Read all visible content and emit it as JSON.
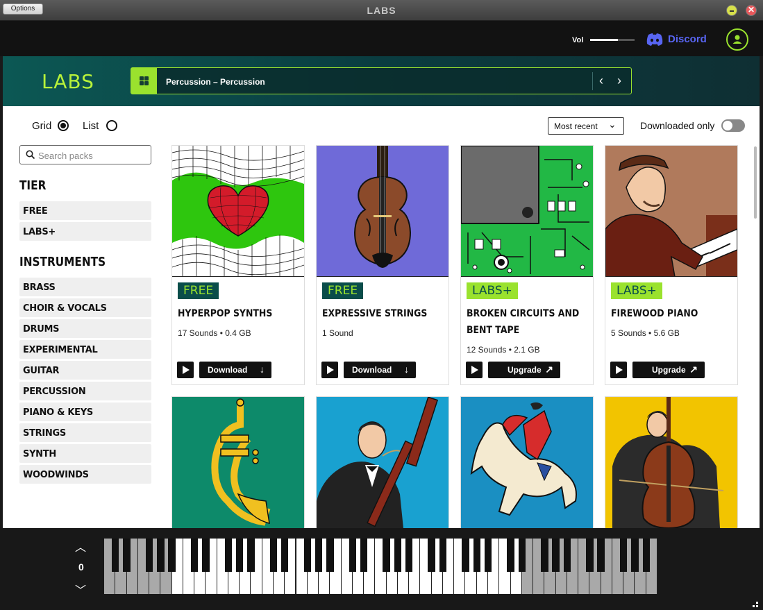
{
  "window": {
    "title": "LABS",
    "options_label": "Options",
    "close_glyph": "✕"
  },
  "topbar": {
    "vol_label": "Vol",
    "volume_level": 0.62,
    "discord_label": "Discord"
  },
  "header": {
    "logo": "LABS",
    "preset_name": "Perсussion  –  Perсussion",
    "prev_glyph": "‹",
    "next_glyph": "›"
  },
  "view": {
    "grid_label": "Grid",
    "list_label": "List",
    "selected": "Grid"
  },
  "sort": {
    "selected": "Most recent",
    "chevron": "⌄"
  },
  "downloaded_only": {
    "label": "Downloaded only",
    "enabled": false
  },
  "search": {
    "placeholder": "Search packs"
  },
  "tier": {
    "title": "TIER",
    "items": [
      "FREE",
      "LABS+"
    ]
  },
  "instruments": {
    "title": "INSTRUMENTS",
    "items": [
      "BRASS",
      "CHOIR & VOCALS",
      "DRUMS",
      "EXPERIMENTAL",
      "GUITAR",
      "PERCUSSION",
      "PIANO & KEYS",
      "STRINGS",
      "SYNTH",
      "WOODWINDS"
    ]
  },
  "cards": [
    {
      "badge": "FREE",
      "title": "HYPERPOP SYNTHS",
      "meta": "17 Sounds • 0.4 GB",
      "action": "Download",
      "action_icon": "↓"
    },
    {
      "badge": "FREE",
      "title": "EXPRESSIVE STRINGS",
      "meta": "1 Sound",
      "action": "Download",
      "action_icon": "↓"
    },
    {
      "badge": "LABS+",
      "title": "BROKEN CIRCUITS AND BENT TAPE",
      "meta": "12 Sounds • 2.1 GB",
      "action": "Upgrade",
      "action_icon": "↗"
    },
    {
      "badge": "LABS+",
      "title": "FIREWOOD PIANO",
      "meta": "5 Sounds • 5.6 GB",
      "action": "Upgrade",
      "action_icon": "↗"
    }
  ],
  "keyboard": {
    "octave": "0",
    "up_glyph": "︿",
    "down_glyph": "﹀"
  },
  "colors": {
    "accent": "#9ae22e",
    "teal": "#0a4d4a",
    "discord": "#5865f2"
  }
}
